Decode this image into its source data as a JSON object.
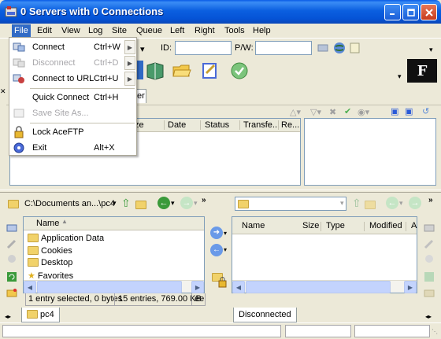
{
  "window": {
    "title": "0 Servers with 0 Connections"
  },
  "menubar": {
    "items": [
      "File",
      "Edit",
      "View",
      "Log",
      "Site",
      "Queue",
      "Left",
      "Right",
      "Tools",
      "Help"
    ]
  },
  "connect_bar": {
    "id_label": "ID:",
    "pw_label": "P/W:"
  },
  "file_menu": {
    "items": [
      {
        "label": "Connect",
        "shortcut": "Ctrl+W"
      },
      {
        "label": "Disconnect",
        "shortcut": "Ctrl+D"
      },
      {
        "label": "Connect to URL",
        "shortcut": "Ctrl+U"
      },
      {
        "label": "Quick Connect",
        "shortcut": "Ctrl+H"
      },
      {
        "label": "Save Site As..."
      },
      {
        "label": "Lock AceFTP"
      },
      {
        "label": "Exit",
        "shortcut": "Alt+X"
      }
    ]
  },
  "queue": {
    "tab_fragment": "er",
    "columns": [
      "ze",
      "Date",
      "Status",
      "Transfe...",
      "Re..."
    ]
  },
  "local": {
    "path": "C:\\Documents an...\\pc4",
    "column_name": "Name",
    "files": [
      "Application Data",
      "Cookies",
      "Desktop",
      "Favorites"
    ],
    "status_selected": "1 entry selected, 0 bytes",
    "status_total": "15 entries, 769.00 KB",
    "status_extra": "ee",
    "tab": "pc4"
  },
  "remote": {
    "columns": [
      "Name",
      "Size",
      "Type",
      "Modified",
      "A"
    ],
    "tab": "Disconnected"
  },
  "colors": {
    "titlebar": "#0a5ce6",
    "menu_highlight": "#316ac5",
    "panel_border": "#7f9db9"
  }
}
